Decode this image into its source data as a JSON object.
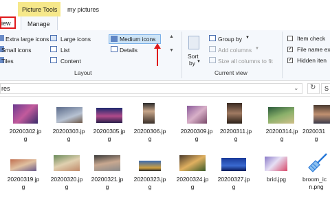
{
  "titlebar": {
    "context_tab": "Picture Tools",
    "window_title": "my pictures"
  },
  "tabs": {
    "view": "iew",
    "manage": "Manage"
  },
  "ribbon": {
    "layout": {
      "items": [
        "Extra large icons",
        "Large icons",
        "Medium icons",
        "Small icons",
        "List",
        "Details",
        "Tiles",
        "Content"
      ],
      "group_label": "Layout"
    },
    "current_view": {
      "sort_label": "Sort",
      "sort_by": "by",
      "group_by": "Group by",
      "add_columns": "Add columns",
      "size_all": "Size all columns to fit",
      "group_label": "Current view"
    },
    "show_hide": {
      "item_check": "Item check",
      "file_name_ext": "File name ex",
      "hidden_items": "Hidden iten",
      "item_check_checked": false,
      "file_name_ext_checked": true,
      "hidden_items_checked": true
    }
  },
  "address": {
    "path": "res",
    "search_letter": "S"
  },
  "files": [
    {
      "name1": "20200302.jp",
      "name2": "g"
    },
    {
      "name1": "20200303.jp",
      "name2": "g"
    },
    {
      "name1": "20200305.jp",
      "name2": "g"
    },
    {
      "name1": "20200306.jp",
      "name2": "g"
    },
    {
      "name1": "20200309.jp",
      "name2": "g"
    },
    {
      "name1": "20200311.jp",
      "name2": "g"
    },
    {
      "name1": "20200314.jp",
      "name2": "g"
    },
    {
      "name1": "2020031",
      "name2": "g"
    },
    {
      "name1": "20200319.jp",
      "name2": "g"
    },
    {
      "name1": "20200320.jp",
      "name2": "g"
    },
    {
      "name1": "20200321.jp",
      "name2": "g"
    },
    {
      "name1": "20200323.jp",
      "name2": "g"
    },
    {
      "name1": "20200324.jp",
      "name2": "g"
    },
    {
      "name1": "20200327.jp",
      "name2": "g"
    },
    {
      "name1": "brid.jpg",
      "name2": ""
    },
    {
      "name1": "broom_ic",
      "name2": "n.png"
    }
  ],
  "colors": {
    "highlight_red": "#e0191b",
    "selection_blue": "#cce4f7",
    "context_tab_yellow": "#f6e88a"
  }
}
